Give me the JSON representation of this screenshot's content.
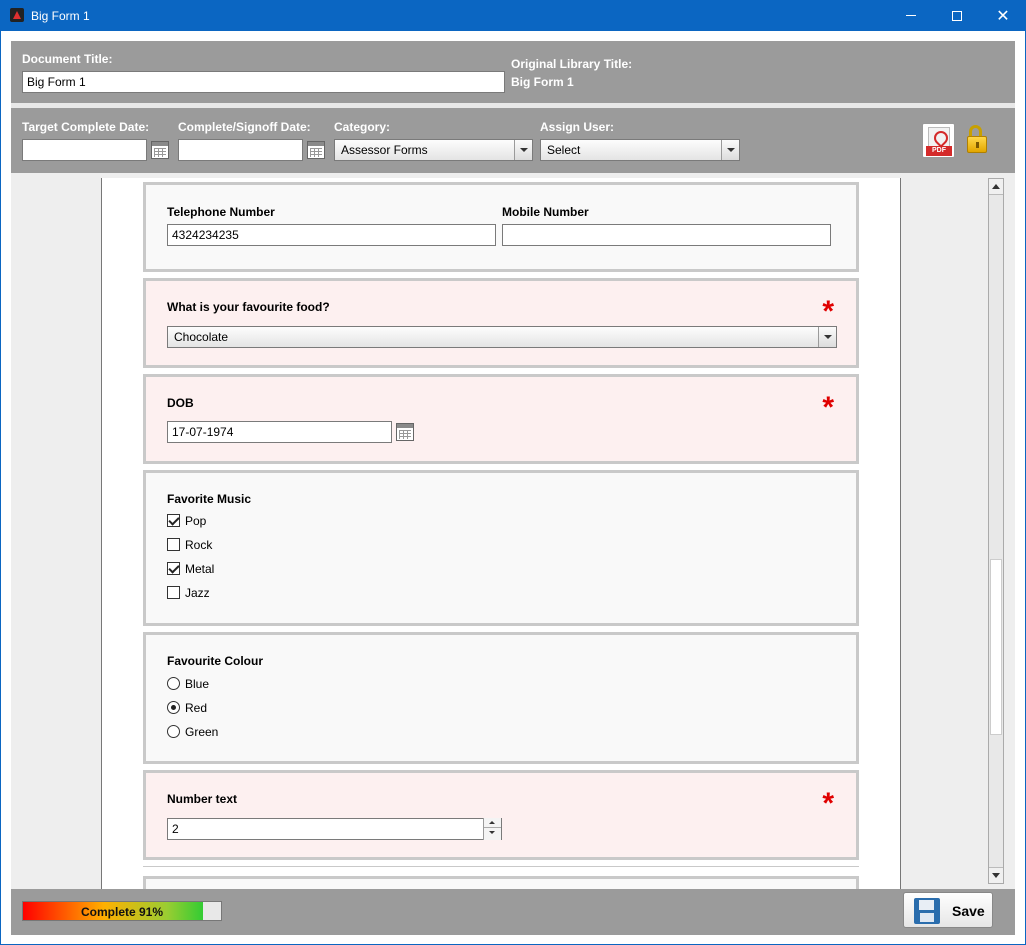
{
  "window": {
    "title": "Big Form 1"
  },
  "header": {
    "doc_title_label": "Document Title:",
    "doc_title_value": "Big Form 1",
    "orig_title_label": "Original Library Title:",
    "orig_title_value": "Big Form 1",
    "target_date_label": "Target Complete Date:",
    "target_date_value": "",
    "signoff_date_label": "Complete/Signoff Date:",
    "signoff_date_value": "",
    "category_label": "Category:",
    "category_value": "Assessor Forms",
    "assign_label": "Assign User:",
    "assign_value": "Select",
    "pdf_tag": "PDF"
  },
  "form": {
    "telephone_label": "Telephone Number",
    "telephone_value": "4324234235",
    "mobile_label": "Mobile Number",
    "mobile_value": "",
    "food_label": "What is your favourite food?",
    "food_value": "Chocolate",
    "dob_label": "DOB",
    "dob_value": "17-07-1974",
    "music_label": "Favorite Music",
    "music_options": [
      {
        "label": "Pop",
        "checked": true
      },
      {
        "label": "Rock",
        "checked": false
      },
      {
        "label": "Metal",
        "checked": true
      },
      {
        "label": "Jazz",
        "checked": false
      }
    ],
    "colour_label": "Favourite Colour",
    "colour_options": [
      {
        "label": "Blue",
        "selected": false
      },
      {
        "label": "Red",
        "selected": true
      },
      {
        "label": "Green",
        "selected": false
      }
    ],
    "number_label": "Number text",
    "number_value": "2",
    "required_mark": "*"
  },
  "footer": {
    "progress_text": "Complete 91%",
    "progress_value": 0.91,
    "save_label": "Save"
  },
  "colors": {
    "titlebar": "#0b66c2",
    "panel": "#9b9b9b",
    "required_star": "#e00000",
    "required_bg": "#fdf0f0"
  }
}
